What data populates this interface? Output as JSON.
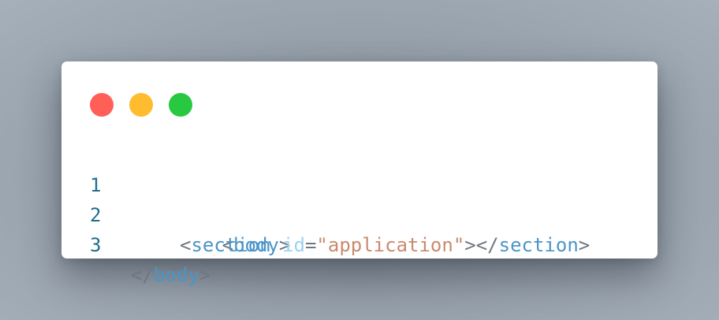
{
  "window": {
    "controls": {
      "close": {
        "color": "#ff5f57"
      },
      "minimize": {
        "color": "#febc2e"
      },
      "maximize": {
        "color": "#28c840"
      }
    }
  },
  "colors": {
    "line_number": "#1f6f86",
    "punctuation": "#6e7781",
    "tag": "#4b95c8",
    "attribute": "#9cd2ee",
    "string": "#c98a6c"
  },
  "code": {
    "lines": [
      {
        "number": "1",
        "tokens": [
          {
            "text": "<",
            "kind": "punctuation"
          },
          {
            "text": "body",
            "kind": "tag"
          },
          {
            "text": ">",
            "kind": "punctuation"
          }
        ]
      },
      {
        "number": "2",
        "tokens": [
          {
            "text": "<",
            "kind": "punctuation"
          },
          {
            "text": "section",
            "kind": "tag"
          },
          {
            "text": " ",
            "kind": "punctuation"
          },
          {
            "text": "id",
            "kind": "attribute"
          },
          {
            "text": "=",
            "kind": "punctuation"
          },
          {
            "text": "\"application\"",
            "kind": "string"
          },
          {
            "text": "></",
            "kind": "punctuation"
          },
          {
            "text": "section",
            "kind": "tag"
          },
          {
            "text": ">",
            "kind": "punctuation"
          }
        ]
      },
      {
        "number": "3",
        "tokens": [
          {
            "text": "</",
            "kind": "punctuation"
          },
          {
            "text": "body",
            "kind": "tag"
          },
          {
            "text": ">",
            "kind": "punctuation"
          }
        ]
      }
    ]
  }
}
